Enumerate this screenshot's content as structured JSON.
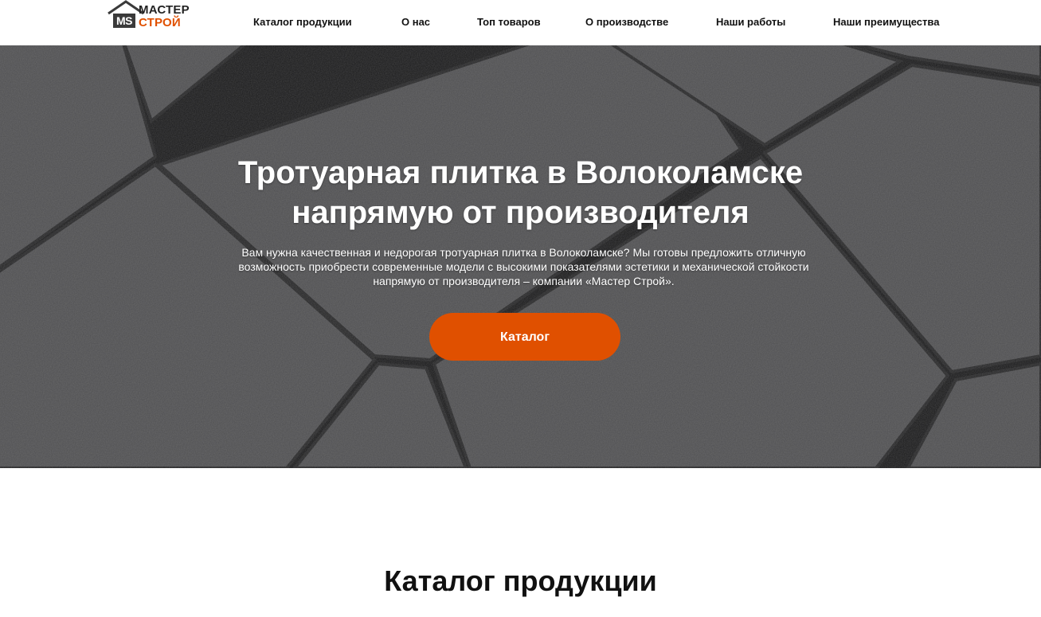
{
  "header": {
    "logo": {
      "mark": "MS",
      "line1": "МАСТЕР",
      "line2": "СТРОЙ"
    },
    "nav": [
      {
        "label": "Каталог продукции"
      },
      {
        "label": "О нас"
      },
      {
        "label": "Топ товаров"
      },
      {
        "label": "О производстве"
      },
      {
        "label": "Наши работы"
      },
      {
        "label": "Наши преимущества"
      }
    ]
  },
  "hero": {
    "title_line1": "Тротуарная плитка в Волоколамске",
    "title_line2": "напрямую от производителя",
    "text": "Вам нужна качественная и недорогая тротуарная плитка в Волоколамске? Мы готовы предложить отличную возможность приобрести современные модели с высокими показателями эстетики и механической стойкости напрямую от производителя – компании «Мастер Строй».",
    "button": "Каталог"
  },
  "catalog": {
    "title": "Каталог продукции"
  },
  "colors": {
    "accent": "#e05000",
    "text": "#111111",
    "hero_overlay": "#4a4a4c",
    "logo_dark": "#3a3a3a"
  }
}
